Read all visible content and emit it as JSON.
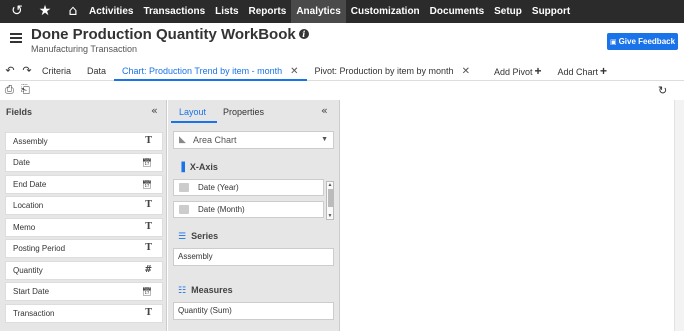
{
  "topnav": {
    "items": [
      "Activities",
      "Transactions",
      "Lists",
      "Reports",
      "Analytics",
      "Customization",
      "Documents",
      "Setup",
      "Support"
    ],
    "active": "Analytics",
    "icons": [
      "recent-icon",
      "star-icon",
      "home-icon"
    ]
  },
  "header": {
    "title": "Done Production Quantity WorkBook",
    "subtitle": "Manufacturing Transaction",
    "feedback_label": "Give Feedback"
  },
  "tabs": [
    {
      "label": "Criteria"
    },
    {
      "label": "Data"
    },
    {
      "label": "Chart: Production Trend by item - month",
      "active": true,
      "closable": true
    },
    {
      "label": "Pivot: Production by item by month",
      "closable": true
    }
  ],
  "add_actions": {
    "add_pivot": "Add Pivot",
    "add_chart": "Add Chart"
  },
  "fields_panel": {
    "title": "Fields",
    "items": [
      {
        "label": "Assembly",
        "type": "T"
      },
      {
        "label": "Date",
        "type": "date"
      },
      {
        "label": "End Date",
        "type": "date"
      },
      {
        "label": "Location",
        "type": "T"
      },
      {
        "label": "Memo",
        "type": "T"
      },
      {
        "label": "Posting Period",
        "type": "T"
      },
      {
        "label": "Quantity",
        "type": "#"
      },
      {
        "label": "Start Date",
        "type": "date"
      },
      {
        "label": "Transaction",
        "type": "T"
      }
    ]
  },
  "layout_panel": {
    "tabs": [
      "Layout",
      "Properties"
    ],
    "chart_type": "Area Chart",
    "xaxis_title": "X-Axis",
    "xaxis_items": [
      "Date (Year)",
      "Date (Month)"
    ],
    "series_title": "Series",
    "series_value": "Assembly",
    "measures_title": "Measures",
    "measures_value": "Quantity (Sum)"
  }
}
